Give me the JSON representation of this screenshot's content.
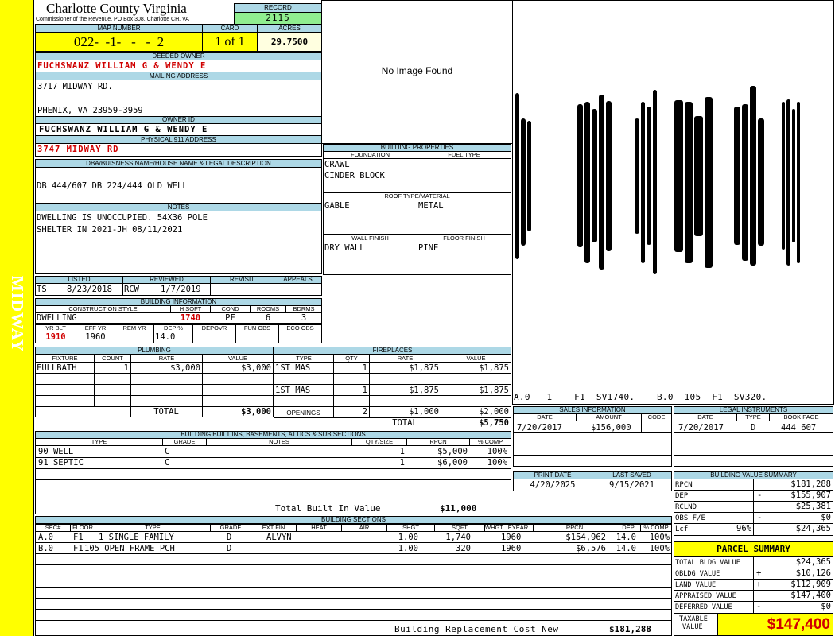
{
  "side_label": "MIDWAY",
  "county": {
    "name": "Charlotte County Virginia",
    "office": "Commissioner of the Revenue, PO Box 308, Charlotte CH, VA"
  },
  "record": {
    "label": "RECORD",
    "value": "2115"
  },
  "map_number": {
    "label": "MAP NUMBER",
    "value": "022-  -1-   -   -  2"
  },
  "card": {
    "label": "CARD",
    "value": "1 of 1"
  },
  "acres": {
    "label": "ACRES",
    "value": "29.7500"
  },
  "deeded_owner": {
    "label": "DEEDED OWNER",
    "value": "FUCHSWANZ WILLIAM G & WENDY E"
  },
  "mailing_address": {
    "label": "MAILING ADDRESS",
    "line1": "3717 MIDWAY RD.",
    "line2": "PHENIX, VA 23959-3959"
  },
  "owner_id": {
    "label": "OWNER ID",
    "value": "FUCHSWANZ WILLIAM G & WENDY E"
  },
  "physical_address": {
    "label": "PHYSICAL 911 ADDRESS",
    "value": "3747 MIDWAY RD"
  },
  "legal": {
    "label": "DBA/BUISNESS NAME/HOUSE NAME & LEGAL DESCRIPTION",
    "value": "DB 444/607 DB 224/444 OLD WELL"
  },
  "notes": {
    "label": "NOTES",
    "line1": "DWELLING IS UNOCCUPIED. 54X36 POLE",
    "line2": "SHELTER IN 2021-JH 08/11/2021"
  },
  "image": {
    "placeholder": "No Image Found"
  },
  "building_properties": {
    "label": "BUILDING PROPERTIES",
    "foundation_label": "FOUNDATION",
    "fuel_label": "FUEL TYPE",
    "foundation1": "CRAWL",
    "foundation2": "CINDER BLOCK",
    "roof_label": "ROOF TYPE/MATERIAL",
    "roof_type": "GABLE",
    "roof_material": "METAL",
    "wall_label": "WALL FINISH",
    "floor_label": "FLOOR FINISH",
    "wall": "DRY WALL",
    "floor": "PINE"
  },
  "sketch": {
    "caption": "A.0   1    F1  SV1740.    B.0  105  F1  SV320.",
    "bar_heights": [
      0.72,
      0.55,
      0.48,
      0.62,
      0.7,
      0.58,
      0.76,
      0.65,
      0.5,
      0.7,
      0.6,
      0.8,
      0.66,
      0.7,
      0.52,
      0.74,
      0.6,
      0.68,
      0.78,
      0.55,
      0.64,
      0.72,
      0.58,
      0.7
    ]
  },
  "listing": {
    "listed_label": "LISTED",
    "reviewed_label": "REVIEWED",
    "revisit_label": "REVISIT",
    "appeals_label": "APPEALS",
    "listed_by": "TS",
    "listed_date": "8/23/2018",
    "reviewed_by": "RCW",
    "reviewed_date": "1/7/2019"
  },
  "building_info": {
    "label": "BUILDING INFORMATION",
    "headers": [
      "CONSTRUCTION STYLE",
      "H SQFT",
      "COND",
      "ROOMS",
      "BDRMS"
    ],
    "style": "DWELLING",
    "hsqft": "1740",
    "cond": "PF",
    "rooms": "6",
    "bdrms": "3",
    "headers2": [
      "YR BLT",
      "EFF YR",
      "REM YR",
      "DEP %",
      "DEPOVR",
      "FUN OBS",
      "ECO OBS"
    ],
    "yr_blt": "1910",
    "eff_yr": "1960",
    "dep": "14.0"
  },
  "plumbing": {
    "label": "PLUMBING",
    "headers": [
      "FIXTURE",
      "COUNT",
      "RATE",
      "VALUE"
    ],
    "rows": [
      {
        "fixture": "FULLBATH",
        "count": "1",
        "rate": "$3,000",
        "value": "$3,000"
      }
    ],
    "total_label": "TOTAL",
    "total": "$3,000"
  },
  "fireplaces": {
    "label": "FIREPLACES",
    "headers": [
      "TYPE",
      "QTY",
      "RATE",
      "VALUE"
    ],
    "rows": [
      {
        "type": "1ST MAS",
        "qty": "1",
        "rate": "$1,875",
        "value": "$1,875"
      },
      {
        "type": "1ST MAS",
        "qty": "1",
        "rate": "$1,875",
        "value": "$1,875"
      }
    ],
    "openings_label": "OPENINGS",
    "openings_qty": "2",
    "openings_rate": "$1,000",
    "openings_value": "$2,000",
    "total_label": "TOTAL",
    "total": "$5,750"
  },
  "sales": {
    "label": "SALES INFORMATION",
    "headers": [
      "DATE",
      "AMOUNT",
      "CODE"
    ],
    "rows": [
      {
        "date": "7/20/2017",
        "amount": "$156,000",
        "code": ""
      }
    ]
  },
  "legal_instruments": {
    "label": "LEGAL INSTRUMENTS",
    "headers": [
      "DATE",
      "TYPE",
      "BOOK PAGE"
    ],
    "rows": [
      {
        "date": "7/20/2017",
        "type": "D",
        "book": "444 607"
      }
    ]
  },
  "built_ins": {
    "label": "BUILDING BUILT INS, BASEMENTS, ATTICS & SUB SECTIONS",
    "headers": [
      "TYPE",
      "GRADE",
      "NOTES",
      "QTY/SIZE",
      "RPCN",
      "% COMP"
    ],
    "rows": [
      {
        "type": "90 WELL",
        "grade": "C",
        "notes": "",
        "qty": "1",
        "rpcn": "$5,000",
        "comp": "100%"
      },
      {
        "type": "91 SEPTIC",
        "grade": "C",
        "notes": "",
        "qty": "1",
        "rpcn": "$6,000",
        "comp": "100%"
      }
    ],
    "total_label": "Total Built In Value",
    "total": "$11,000"
  },
  "print_info": {
    "print_label": "PRINT DATE",
    "saved_label": "LAST SAVED",
    "print_date": "4/20/2025",
    "last_saved": "9/15/2021"
  },
  "value_summary": {
    "label": "BUILDING VALUE SUMMARY",
    "rows": [
      {
        "label": "RPCN",
        "sign": "",
        "value": "$181,288"
      },
      {
        "label": "DEP",
        "sign": "-",
        "value": "$155,907"
      },
      {
        "label": "RCLND",
        "sign": "",
        "value": "$25,381"
      },
      {
        "label": "OBS F/E",
        "sign": "-",
        "value": "$0"
      },
      {
        "label": "Lcf",
        "pct": "96%",
        "sign": "",
        "value": "$24,365"
      }
    ]
  },
  "building_sections": {
    "label": "BUILDING SECTIONS",
    "headers": [
      "SEC#",
      "FLOOR",
      "TYPE",
      "GRADE",
      "EXT FIN",
      "HEAT",
      "AIR",
      "SHGT",
      "SQFT",
      "WHGT",
      "EYEAR",
      "RPCN",
      "DEP",
      "% COMP"
    ],
    "rows": [
      {
        "sec": "A.0",
        "floor": "F1",
        "type": "1 SINGLE FAMILY",
        "grade": "D",
        "ext": "ALVYN",
        "heat": "",
        "air": "",
        "shgt": "1.00",
        "sqft": "1,740",
        "whgt": "",
        "eyear": "1960",
        "rpcn": "$154,962",
        "dep": "14.0",
        "comp": "100%"
      },
      {
        "sec": "B.0",
        "floor": "F1",
        "type": "105 OPEN FRAME PCH",
        "grade": "D",
        "ext": "",
        "heat": "",
        "air": "",
        "shgt": "1.00",
        "sqft": "320",
        "whgt": "",
        "eyear": "1960",
        "rpcn": "$6,576",
        "dep": "14.0",
        "comp": "100%"
      }
    ],
    "replacement_label": "Building Replacement Cost New",
    "replacement": "$181,288"
  },
  "parcel_summary": {
    "label": "PARCEL SUMMARY",
    "rows": [
      {
        "label": "TOTAL BLDG VALUE",
        "sign": "",
        "value": "$24,365"
      },
      {
        "label": "OBLDG VALUE",
        "sign": "+",
        "value": "$10,126"
      },
      {
        "label": "LAND VALUE",
        "sign": "+",
        "value": "$112,909"
      },
      {
        "label": "APPRAISED VALUE",
        "sign": "",
        "value": "$147,400"
      },
      {
        "label": "DEFERRED VALUE",
        "sign": "-",
        "value": "$0"
      }
    ],
    "taxable_label1": "TAXABLE",
    "taxable_label2": "VALUE",
    "taxable": "$147,400"
  },
  "colors": {
    "sidebar": "#ffff00",
    "header": "#add8e6",
    "record": "#90ee90",
    "map": "#ffff00",
    "acres": "#ffffe0",
    "red": "#d00000"
  }
}
